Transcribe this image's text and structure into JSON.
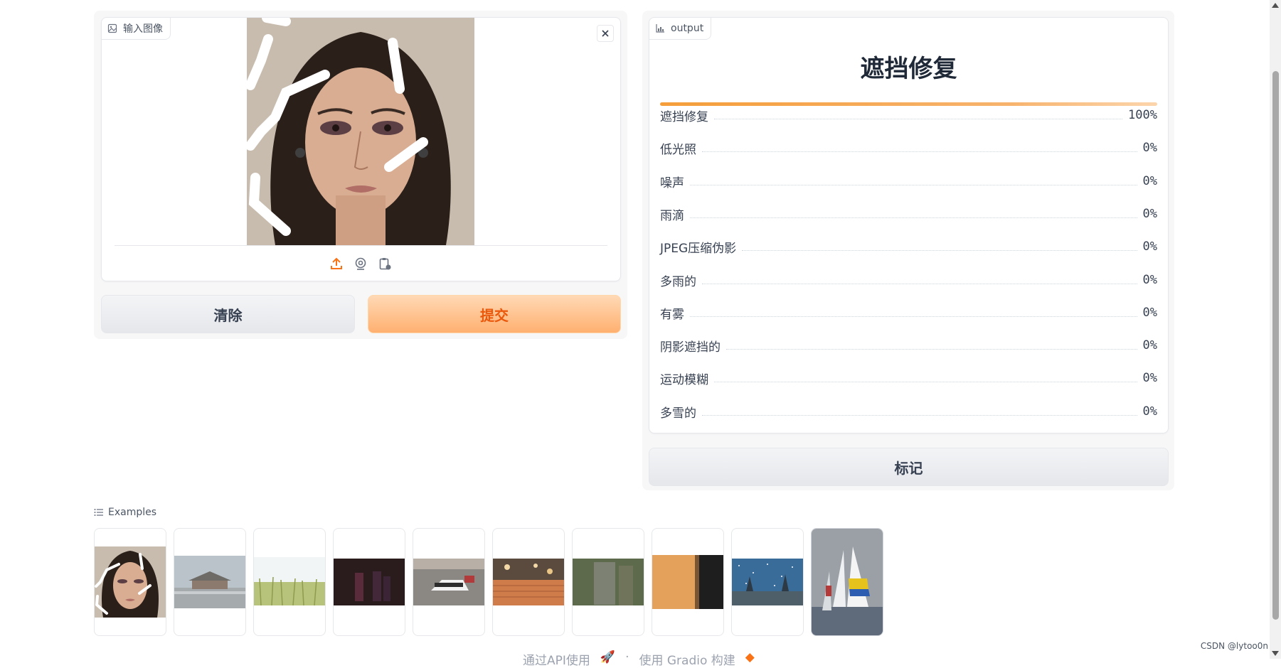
{
  "input_panel": {
    "label": "输入图像",
    "label_icon": "image-icon",
    "close_icon": "close-icon",
    "tools": [
      "upload-icon",
      "webcam-icon",
      "clipboard-icon"
    ]
  },
  "buttons": {
    "clear": "清除",
    "submit": "提交",
    "flag": "标记"
  },
  "output_panel": {
    "label": "output",
    "label_icon": "bar-chart-icon",
    "top_class": "遮挡修复",
    "top_confidence": 1.0,
    "confidences": [
      {
        "label": "遮挡修复",
        "value": "100%"
      },
      {
        "label": "低光照",
        "value": "0%"
      },
      {
        "label": "噪声",
        "value": "0%"
      },
      {
        "label": "雨滴",
        "value": "0%"
      },
      {
        "label": "JPEG压缩伪影",
        "value": "0%"
      },
      {
        "label": "多雨的",
        "value": "0%"
      },
      {
        "label": "有雾",
        "value": "0%"
      },
      {
        "label": "阴影遮挡的",
        "value": "0%"
      },
      {
        "label": "运动模糊",
        "value": "0%"
      },
      {
        "label": "多雪的",
        "value": "0%"
      }
    ]
  },
  "examples": {
    "label": "Examples",
    "items": [
      "occluded-face-thumbnail",
      "hazy-palace-thumbnail",
      "bright-grass-thumbnail",
      "dark-lowlight-thumbnail",
      "racing-cars-thumbnail",
      "stairs-rain-thumbnail",
      "motion-blur-thumbnail",
      "shadowed-wall-thumbnail",
      "snowy-scene-thumbnail",
      "sailboats-thumbnail"
    ]
  },
  "footer": {
    "api_text": "通过API使用",
    "built_text": "使用 Gradio 构建"
  },
  "watermark": "CSDN @lytoo0n",
  "colors": {
    "accent": "#f97316",
    "primary_button_bg": "#ffc08a",
    "primary_button_text": "#ea580c",
    "panel_bg": "#f7f7f8"
  }
}
